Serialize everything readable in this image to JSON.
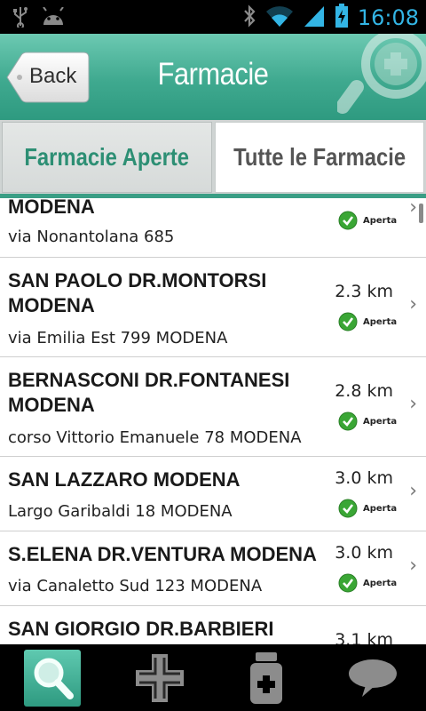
{
  "app": {
    "title": "Farmacie",
    "back_label": "Back"
  },
  "status_bar": {
    "time": "16:08",
    "icons": [
      "usb-icon",
      "android-icon",
      "bluetooth-icon",
      "wifi-icon",
      "signal-icon",
      "battery-charging-icon"
    ]
  },
  "tabs": [
    {
      "label": "Farmacie Aperte",
      "selected": true
    },
    {
      "label": "Tutte le Farmacie",
      "selected": false
    }
  ],
  "pharmacies": [
    {
      "name": "MODENA",
      "address": "via Nonantolana 685",
      "distance": "",
      "status": "Aperta"
    },
    {
      "name": "SAN PAOLO DR.MONTORSI MODENA",
      "address": "via Emilia Est 799 MODENA",
      "distance": "2.3 km",
      "status": "Aperta"
    },
    {
      "name": "BERNASCONI DR.FONTANESI MODENA",
      "address": "corso Vittorio Emanuele 78 MODENA",
      "distance": "2.8 km",
      "status": "Aperta"
    },
    {
      "name": "SAN LAZZARO MODENA",
      "address": "Largo Garibaldi 18 MODENA",
      "distance": "3.0 km",
      "status": "Aperta"
    },
    {
      "name": "S.ELENA DR.VENTURA MODENA",
      "address": "via Canaletto Sud 123 MODENA",
      "distance": "3.0 km",
      "status": "Aperta"
    },
    {
      "name": "SAN GIORGIO DR.BARBIERI",
      "address": "",
      "distance": "3.1 km",
      "status": ""
    }
  ],
  "bottom_nav": [
    {
      "icon": "search-icon",
      "selected": true
    },
    {
      "icon": "pharmacy-cross-icon",
      "selected": false
    },
    {
      "icon": "medicine-bottle-icon",
      "selected": false
    },
    {
      "icon": "chat-bubble-icon",
      "selected": false
    }
  ],
  "colors": {
    "accent": "#3fa98f",
    "tab_active_text": "#2d8f74",
    "status_bar_icons": "#33b5e5",
    "open_badge": "#3aa635"
  }
}
